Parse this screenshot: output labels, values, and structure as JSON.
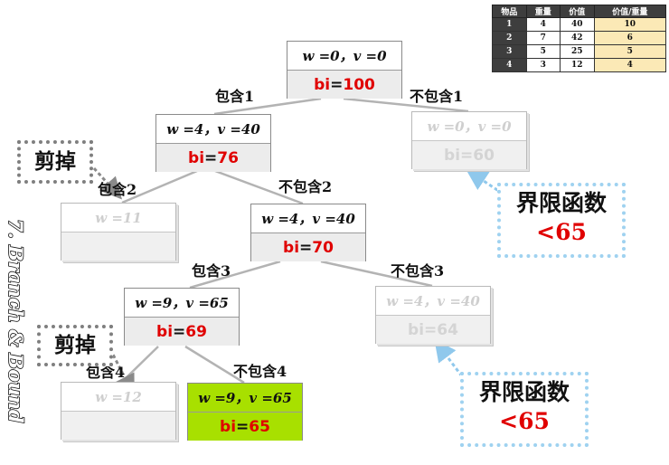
{
  "tree": {
    "nodes": [
      {
        "id": "root",
        "w": "w =0",
        "v": "v =0",
        "bi_key": "bi",
        "bi_val": "100",
        "state": "active"
      },
      {
        "id": "n1",
        "w": "w =4",
        "v": "v =40",
        "bi_key": "bi",
        "bi_val": "76",
        "state": "active"
      },
      {
        "id": "n2",
        "w": "w =0",
        "v": "v =0",
        "bi_key": "bi",
        "bi_val": "60",
        "state": "faded"
      },
      {
        "id": "n3",
        "w": "w =11",
        "v": "",
        "bi_key": "",
        "bi_val": "",
        "state": "faded"
      },
      {
        "id": "n4",
        "w": "w =4",
        "v": "v =40",
        "bi_key": "bi",
        "bi_val": "70",
        "state": "active"
      },
      {
        "id": "n5",
        "w": "w =9",
        "v": "v =65",
        "bi_key": "bi",
        "bi_val": "69",
        "state": "active"
      },
      {
        "id": "n6",
        "w": "w =4",
        "v": "v =40",
        "bi_key": "bi",
        "bi_val": "64",
        "state": "faded"
      },
      {
        "id": "n7",
        "w": "w =12",
        "v": "",
        "bi_key": "",
        "bi_val": "",
        "state": "faded"
      },
      {
        "id": "n8",
        "w": "w =9",
        "v": "v =65",
        "bi_key": "bi",
        "bi_val": "65",
        "state": "best"
      }
    ],
    "edges": [
      {
        "from": "root",
        "to": "n1",
        "label": "包含1"
      },
      {
        "from": "root",
        "to": "n2",
        "label": "不包含1"
      },
      {
        "from": "n1",
        "to": "n3",
        "label": "包含2"
      },
      {
        "from": "n1",
        "to": "n4",
        "label": "不包含2"
      },
      {
        "from": "n4",
        "to": "n5",
        "label": "包含3"
      },
      {
        "from": "n4",
        "to": "n6",
        "label": "不包含3"
      },
      {
        "from": "n5",
        "to": "n7",
        "label": "包含4"
      },
      {
        "from": "n5",
        "to": "n8",
        "label": "不包含4"
      }
    ]
  },
  "callouts": {
    "prune_1": "剪掉",
    "prune_2": "剪掉",
    "bound_1": {
      "label": "界限函数",
      "value": "<65"
    },
    "bound_2": {
      "label": "界限函数",
      "value": "<65"
    }
  },
  "items_table": {
    "headers": [
      "物品",
      "重量",
      "价值",
      "价值/重量"
    ],
    "rows": [
      [
        "1",
        "4",
        "40",
        "10"
      ],
      [
        "2",
        "7",
        "42",
        "6"
      ],
      [
        "3",
        "5",
        "25",
        "5"
      ],
      [
        "4",
        "3",
        "12",
        "4"
      ]
    ]
  },
  "side_title": "7. Branch & Bound",
  "colors": {
    "bound_red": "#e00000",
    "best_node": "#a8e000",
    "bound_callout": "#9fd2f0",
    "prune_callout": "#7f7f7f",
    "edge": "#b3b3b3"
  }
}
